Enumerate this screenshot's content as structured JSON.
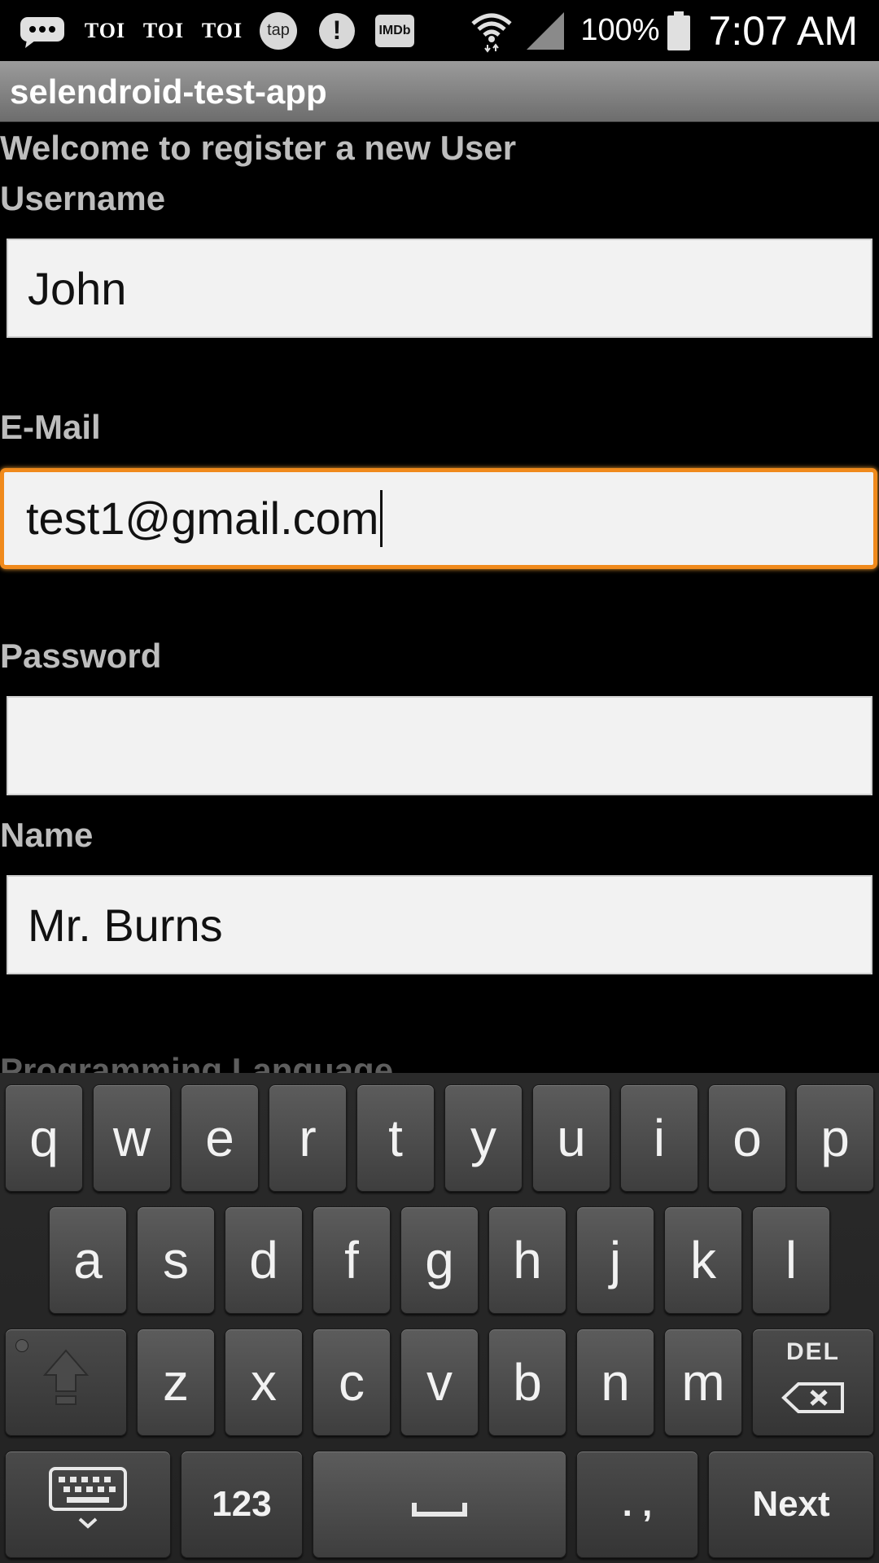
{
  "status_bar": {
    "notifications": [
      {
        "icon": "chat-bubble-icon"
      },
      {
        "icon": "toi-icon",
        "text": "TOI"
      },
      {
        "icon": "toi-icon",
        "text": "TOI"
      },
      {
        "icon": "toi-icon",
        "text": "TOI"
      },
      {
        "icon": "tap-icon",
        "text": "tap"
      },
      {
        "icon": "alert-icon",
        "text": "!"
      },
      {
        "icon": "imdb-icon",
        "text": "IMDb"
      }
    ],
    "battery_percent": "100%",
    "time": "7:07 AM"
  },
  "app": {
    "title": "selendroid-test-app"
  },
  "form": {
    "welcome": "Welcome to register a new User",
    "username": {
      "label": "Username",
      "value": "John"
    },
    "email": {
      "label": "E-Mail",
      "value": "test1@gmail.com"
    },
    "password": {
      "label": "Password",
      "value": ""
    },
    "name": {
      "label": "Name",
      "value": "Mr. Burns"
    },
    "programming_language": {
      "label": "Programming Language"
    }
  },
  "keyboard": {
    "row1": [
      "q",
      "w",
      "e",
      "r",
      "t",
      "y",
      "u",
      "i",
      "o",
      "p"
    ],
    "row2": [
      "a",
      "s",
      "d",
      "f",
      "g",
      "h",
      "j",
      "k",
      "l"
    ],
    "row3": [
      "z",
      "x",
      "c",
      "v",
      "b",
      "n",
      "m"
    ],
    "del_label": "DEL",
    "numbers_label": "123",
    "punct_label": ". ,",
    "next_label": "Next"
  },
  "colors": {
    "focus": "#f08a1c",
    "field_bg": "#f2f2f2",
    "label": "#bdbdbd"
  }
}
